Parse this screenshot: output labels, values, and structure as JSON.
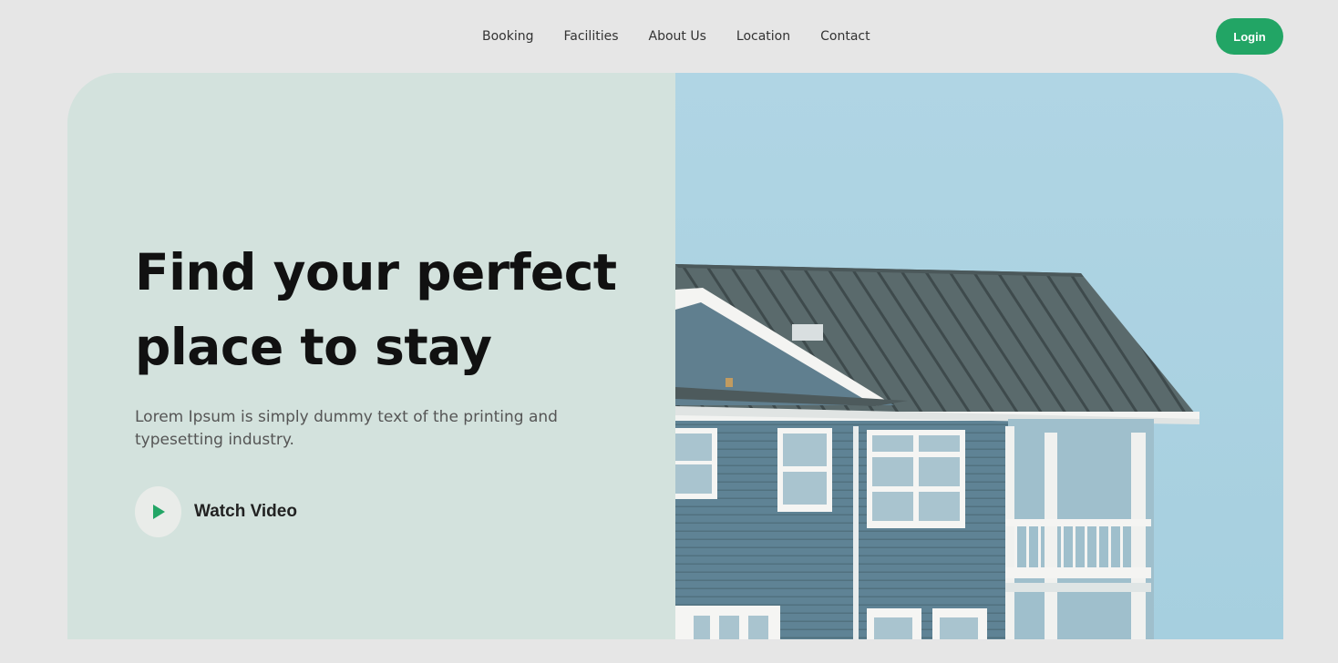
{
  "nav": {
    "links": [
      "Booking",
      "Facilities",
      "About Us",
      "Location",
      "Contact"
    ],
    "login_label": "Login"
  },
  "hero": {
    "title_line1": "Find your perfect",
    "title_line2": "place to stay",
    "subtitle": "Lorem Ipsum is simply dummy text of the printing and typesetting industry.",
    "watch_label": "Watch Video"
  },
  "colors": {
    "accent": "#22a565",
    "page_bg": "#e6e6e6",
    "hero_left_bg": "#d3e2dd",
    "sky": "#b3d7e3"
  },
  "icons": {
    "play": "play-icon"
  }
}
